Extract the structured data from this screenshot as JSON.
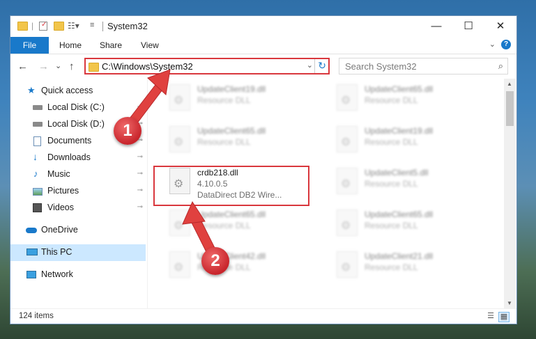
{
  "window": {
    "title": "System32",
    "controls": {
      "minimize": "—",
      "maximize": "☐",
      "close": "✕"
    }
  },
  "ribbon": {
    "tabs": [
      {
        "label": "File"
      },
      {
        "label": "Home"
      },
      {
        "label": "Share"
      },
      {
        "label": "View"
      }
    ],
    "help": "?"
  },
  "address": {
    "path": "C:\\Windows\\System32",
    "search_placeholder": "Search System32"
  },
  "icons": {
    "back": "←",
    "forward": "→",
    "recent": "⌄",
    "up": "↑",
    "dropdown": "⌄",
    "refresh": "↻",
    "search": "⌕",
    "pin": "📌"
  },
  "sidebar": {
    "items": [
      {
        "label": "Quick access",
        "icon": "star-icon"
      },
      {
        "label": "Local Disk (C:)",
        "icon": "drive-icon"
      },
      {
        "label": "Local Disk (D:)",
        "icon": "drive-icon"
      },
      {
        "label": "Documents",
        "icon": "document-icon"
      },
      {
        "label": "Downloads",
        "icon": "download-icon"
      },
      {
        "label": "Music",
        "icon": "music-icon"
      },
      {
        "label": "Pictures",
        "icon": "picture-icon"
      },
      {
        "label": "Videos",
        "icon": "video-icon"
      },
      {
        "label": "OneDrive",
        "icon": "cloud-icon"
      },
      {
        "label": "This PC",
        "icon": "computer-icon"
      },
      {
        "label": "Network",
        "icon": "network-icon"
      }
    ]
  },
  "files": {
    "highlighted": {
      "name": "crdb218.dll",
      "version": "4.10.0.5",
      "description": "DataDirect DB2 Wire..."
    },
    "blurred": [
      {
        "name": "UpdateClient19.dll",
        "desc": "Resource DLL"
      },
      {
        "name": "UpdateClient65.dll",
        "desc": "Resource DLL"
      },
      {
        "name": "UpdateClient65.dll",
        "desc": "Resource DLL"
      },
      {
        "name": "UpdateClient19.dll",
        "desc": "Resource DLL"
      },
      {
        "name": "UpdateClient5.dll",
        "desc": "Resource DLL"
      },
      {
        "name": "UpdateClient65.dll",
        "desc": "Resource DLL"
      },
      {
        "name": "UpdateClient65.dll",
        "desc": "Resource DLL"
      },
      {
        "name": "UpdateClient42.dll",
        "desc": "Resource DLL"
      },
      {
        "name": "UpdateClient21.dll",
        "desc": "Resource DLL"
      }
    ]
  },
  "status": {
    "item_count": "124 items"
  },
  "annotations": {
    "step1": "1",
    "step2": "2"
  },
  "colors": {
    "accent": "#1979ca",
    "highlight": "#d9373d",
    "selected": "#cce8ff"
  }
}
